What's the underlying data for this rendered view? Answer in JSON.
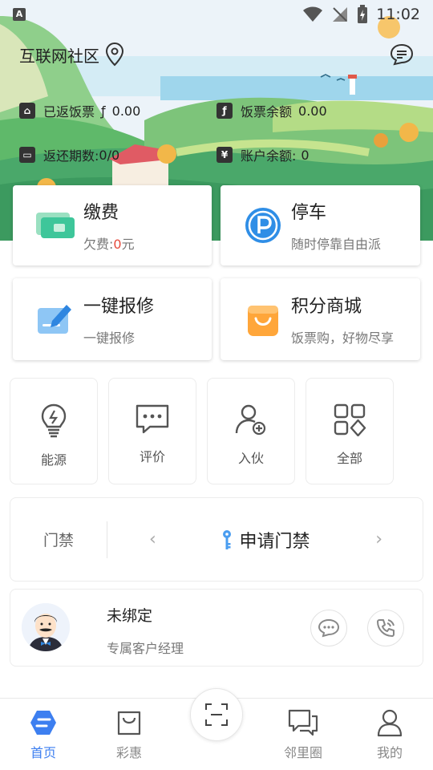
{
  "status_bar": {
    "time": "11:02",
    "app_badge": "A"
  },
  "header": {
    "community": "互联网社区"
  },
  "info": {
    "returned_label": "已返饭票",
    "returned_value": "0.00",
    "coupon_balance_label": "饭票余额",
    "coupon_balance_value": "0.00",
    "return_period_label": "返还期数:",
    "return_period_value": "0/0",
    "account_balance_label": "账户余额:",
    "account_balance_value": "0"
  },
  "cards": {
    "pay": {
      "title": "缴费",
      "sub_prefix": "欠费:",
      "amount": "0",
      "unit": "元"
    },
    "parking": {
      "title": "停车",
      "sub": "随时停靠自由派"
    },
    "repair": {
      "title": "一键报修",
      "sub": "一键报修"
    },
    "mall": {
      "title": "积分商城",
      "sub": "饭票购，好物尽享"
    }
  },
  "tiles": [
    {
      "label": "能源",
      "icon": "lightbulb-icon"
    },
    {
      "label": "评价",
      "icon": "comment-icon"
    },
    {
      "label": "入伙",
      "icon": "add-user-icon"
    },
    {
      "label": "全部",
      "icon": "grid-icon"
    }
  ],
  "access": {
    "label": "门禁",
    "action": "申请门禁",
    "prev": "‹",
    "next": "›"
  },
  "manager": {
    "name": "未绑定",
    "role": "专属客户经理"
  },
  "nav": [
    {
      "label": "首页",
      "icon": "home-icon",
      "active": true
    },
    {
      "label": "彩惠",
      "icon": "bag-icon"
    },
    {
      "label": "邻里圈",
      "icon": "chat-icon"
    },
    {
      "label": "我的",
      "icon": "profile-icon"
    }
  ],
  "colors": {
    "accent": "#3d7ff0",
    "red": "#e54a3c",
    "text": "#222222",
    "subtext": "#777777"
  }
}
